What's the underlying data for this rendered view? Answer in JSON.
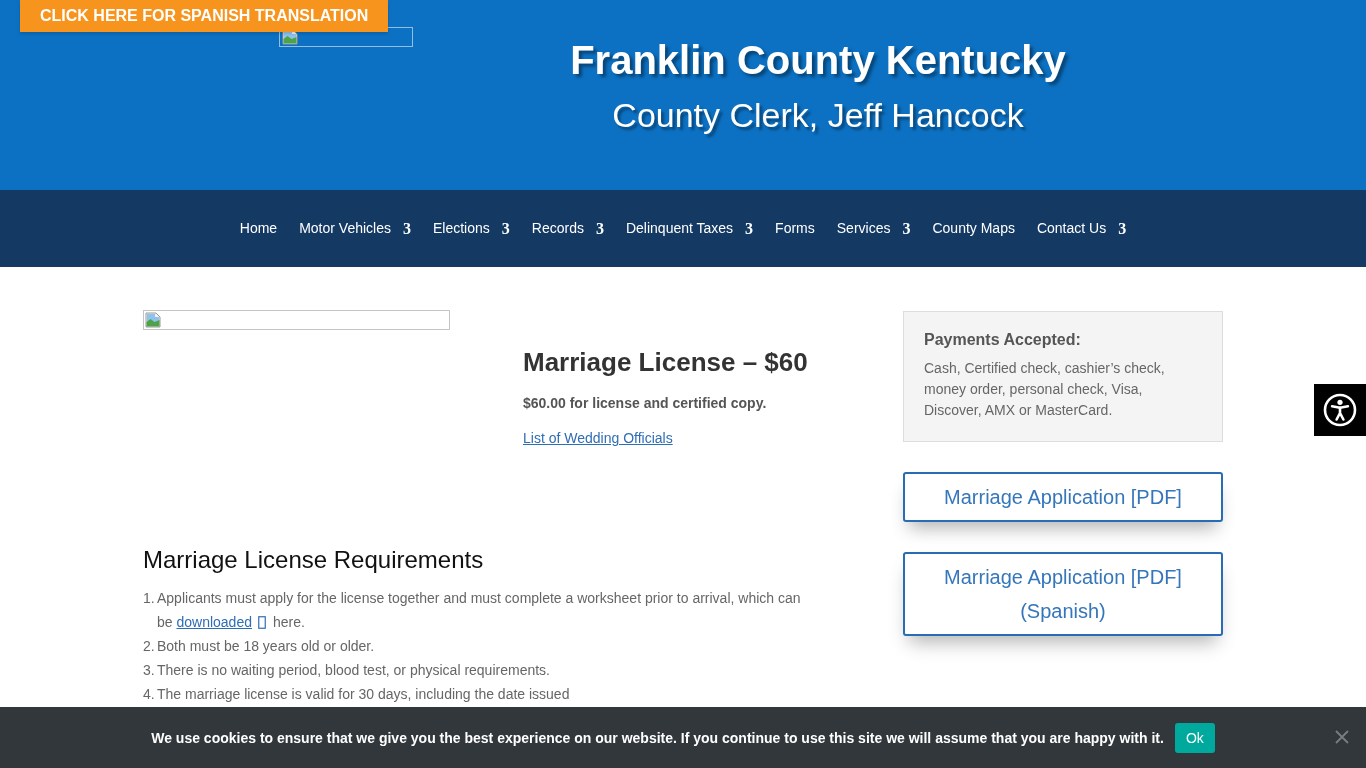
{
  "translate_banner": {
    "label": "CLICK HERE FOR SPANISH TRANSLATION"
  },
  "header": {
    "title": "Franklin County Kentucky",
    "subtitle": "County Clerk, Jeff Hancock"
  },
  "nav": {
    "items": [
      {
        "label": "Home"
      },
      {
        "label": "Motor Vehicles",
        "caret": "3"
      },
      {
        "label": "Elections",
        "caret": "3"
      },
      {
        "label": "Records",
        "caret": "3"
      },
      {
        "label": "Delinquent Taxes",
        "caret": "3"
      },
      {
        "label": "Forms"
      },
      {
        "label": "Services",
        "caret": "3"
      },
      {
        "label": "County Maps"
      },
      {
        "label": "Contact Us",
        "caret": "3"
      }
    ]
  },
  "license": {
    "title": "Marriage License – $60",
    "fee_note": "$60.00 for license and certified copy.",
    "link": "List of Wedding Officials"
  },
  "requirements": {
    "title": "Marriage License Requirements",
    "items": [
      {
        "number": "1.",
        "text": "Applicants must apply for the license together and must complete a worksheet prior to arrival, which can be",
        "link": "downloaded",
        "text_after": "here."
      },
      {
        "number": "2.",
        "text": "Both must be 18 years old or older."
      },
      {
        "number": "3.",
        "text": "There is no waiting period, blood test, or physical requirements."
      },
      {
        "number": "4.",
        "text": "The marriage license is valid for 30 days, including the date issued"
      }
    ]
  },
  "sidebar": {
    "payments": {
      "title": "Payments Accepted:",
      "text": "Cash, Certified check, cashier’s check, money order, personal check, Visa, Discover, AMX or MasterCard."
    },
    "buttons": [
      "Marriage Application [PDF]",
      "Marriage Application [PDF] (Spanish)"
    ]
  },
  "cookie_notice": {
    "text": "We use cookies to ensure that we give you the best experience on our website. If you continue to use this site we will assume that you are happy with it.",
    "button": "Ok"
  }
}
